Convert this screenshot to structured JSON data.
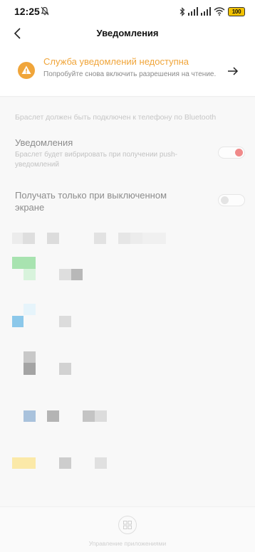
{
  "status_bar": {
    "time": "12:25",
    "battery": "100"
  },
  "header": {
    "title": "Уведомления"
  },
  "warning": {
    "title": "Служба уведомлений недоступна",
    "description": "Попробуйте снова включить разрешения на чтение.",
    "accent_color": "#f0a53a"
  },
  "hint": "Браслет должен быть подключен к телефону по Bluetooth",
  "settings": {
    "notifications": {
      "title": "Уведомления",
      "subtitle": "Браслет будет вибрировать при получении push-уведомлений",
      "enabled": true,
      "accent_color": "#f08a8a"
    },
    "screen_off_only": {
      "title": "Получать только при выключенном экране",
      "enabled": false
    }
  },
  "bottom_bar": {
    "label": "Управление приложениями"
  }
}
